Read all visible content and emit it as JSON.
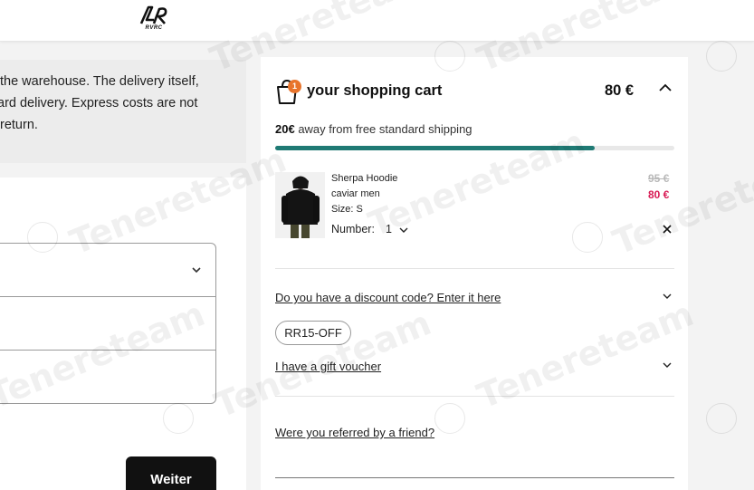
{
  "brand": {
    "logo_text": "RVRC"
  },
  "info": {
    "lines": [
      "the warehouse. The delivery itself,",
      "ard delivery. Express costs are not",
      "return."
    ]
  },
  "form": {
    "continue_label": "Weiter"
  },
  "cart": {
    "title": "your shopping cart",
    "item_count": "1",
    "total": "80 €",
    "shipping": {
      "amount": "20€",
      "text": " away from free standard shipping",
      "progress": 0.8
    },
    "item": {
      "name": "Sherpa Hoodie",
      "subtitle": "caviar men",
      "size": "Size: S",
      "number_label": "Number:",
      "number_value": "1",
      "price_old": "95 €",
      "price_new": "80 €"
    },
    "discount_link": "Do you have a discount code? Enter it here",
    "discount_code": "RR15-OFF",
    "gift_link": "I have a gift voucher",
    "referral_link": "Were you referred by a friend?"
  },
  "watermark": {
    "text": "Tenereteam"
  },
  "colors": {
    "progress": "#1f7a74",
    "sale_price": "#d81b54",
    "badge": "#e8742c",
    "button": "#111111"
  }
}
